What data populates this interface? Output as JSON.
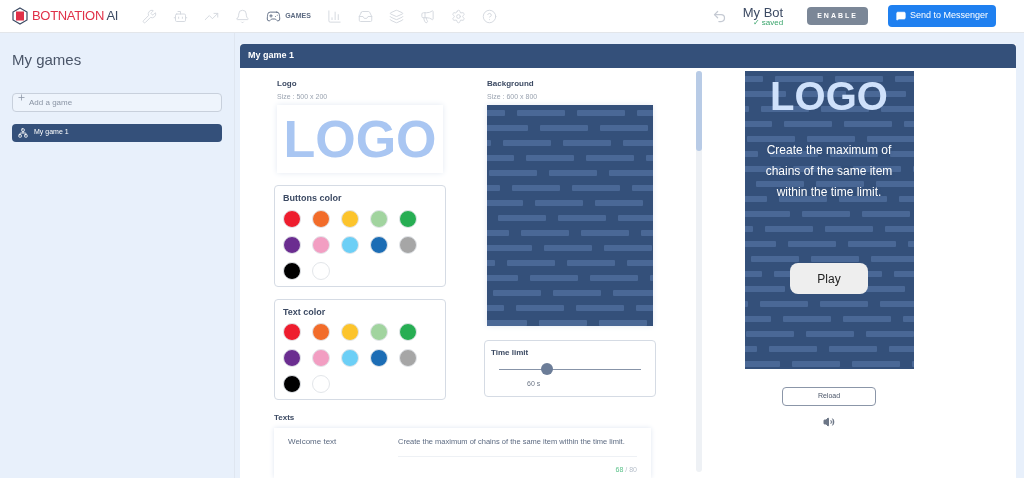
{
  "header": {
    "brand_left": "BOTNATION",
    "brand_right": " AI",
    "nav": [
      {
        "selected": false
      },
      {
        "selected": false
      },
      {
        "selected": false
      },
      {
        "selected": false
      },
      {
        "label": "GAMES",
        "selected": true
      },
      {
        "selected": false
      },
      {
        "selected": false
      },
      {
        "selected": false
      },
      {
        "selected": false
      },
      {
        "selected": false
      },
      {
        "selected": false
      }
    ],
    "bot_name": "My Bot",
    "saved": "✓ saved",
    "enable_button": "ENABLE",
    "messenger_button": "Send to Messenger"
  },
  "sidebar": {
    "title": "My games",
    "add_placeholder": "Add a game",
    "games": [
      {
        "name": "My game 1",
        "selected": true
      }
    ]
  },
  "editor": {
    "title": "My game 1",
    "logo": {
      "label": "Logo",
      "size": "Size : 500 x 200",
      "image_text": "LOGO"
    },
    "buttons_color": {
      "label": "Buttons color",
      "swatches": [
        {
          "color": "#ee1d2e"
        },
        {
          "color": "#f26c2a"
        },
        {
          "color": "#fcc42c"
        },
        {
          "color": "#a1d49f"
        },
        {
          "color": "#27ae53"
        },
        {
          "color": "#6b2d90"
        },
        {
          "color": "#f29ec2"
        },
        {
          "color": "#6ccff6"
        },
        {
          "color": "#1c6db5"
        },
        {
          "color": "#a6a6a6"
        },
        {
          "color": "#000000"
        },
        {
          "color": "#ffffff"
        }
      ]
    },
    "text_color": {
      "label": "Text color",
      "swatches": [
        {
          "color": "#ee1d2e"
        },
        {
          "color": "#f26c2a"
        },
        {
          "color": "#fcc42c"
        },
        {
          "color": "#a1d49f"
        },
        {
          "color": "#27ae53"
        },
        {
          "color": "#6b2d90"
        },
        {
          "color": "#f29ec2"
        },
        {
          "color": "#6ccff6"
        },
        {
          "color": "#1c6db5"
        },
        {
          "color": "#a6a6a6"
        },
        {
          "color": "#000000"
        },
        {
          "color": "#ffffff"
        }
      ]
    },
    "background": {
      "label": "Background",
      "size": "Size : 600 x 800"
    },
    "time_limit": {
      "label": "Time limit",
      "level": 0.34,
      "reading": "60 s"
    },
    "texts": {
      "label": "Texts",
      "fields": [
        {
          "label": "Welcome text",
          "value": "Create the maximum of chains of the same item within the time limit.",
          "count": "68",
          "limit": "/ 80"
        }
      ]
    }
  },
  "preview": {
    "logo_text": "LOGO",
    "message": "Create the maximum of chains of the same item within the time limit.",
    "play_button": "Play",
    "reload_button": "Reload"
  }
}
